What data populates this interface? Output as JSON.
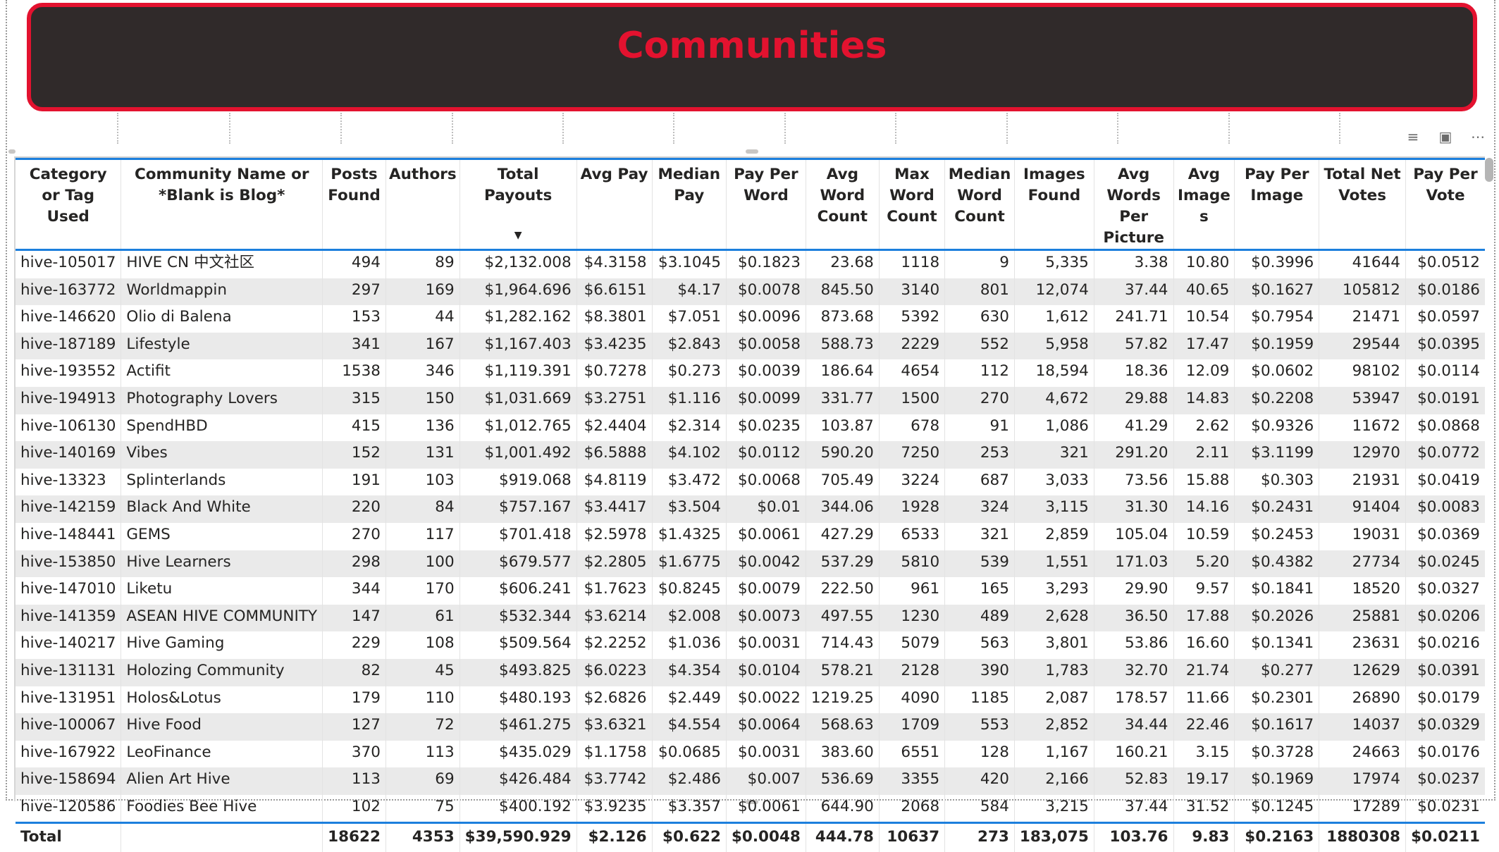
{
  "banner": {
    "title": "Communities"
  },
  "toolbar": {
    "filter_icon": "filter-icon",
    "focus_icon": "focus-mode-icon",
    "more_icon": "more-options-icon"
  },
  "colors": {
    "accent_red": "#e3122f",
    "banner_bg": "#302a2a",
    "header_rule": "#1c7fdd"
  },
  "table": {
    "sorted_column": "Total Payouts",
    "sort_direction": "descending",
    "headers": [
      "Category or Tag Used",
      "Community Name or *Blank is Blog*",
      "Posts Found",
      "Authors",
      "Total Payouts",
      "Avg Pay",
      "Median Pay",
      "Pay Per Word",
      "Avg Word Count",
      "Max Word Count",
      "Median Word Count",
      "Images Found",
      "Avg Words Per Picture",
      "Avg Image s",
      "Pay Per Image",
      "Total Net Votes",
      "Pay Per Vote"
    ],
    "rows": [
      [
        "hive-105017",
        "HIVE CN 中文社区",
        "494",
        "89",
        "$2,132.008",
        "$4.3158",
        "$3.1045",
        "$0.1823",
        "23.68",
        "1118",
        "9",
        "5,335",
        "3.38",
        "10.80",
        "$0.3996",
        "41644",
        "$0.0512"
      ],
      [
        "hive-163772",
        "Worldmappin",
        "297",
        "169",
        "$1,964.696",
        "$6.6151",
        "$4.17",
        "$0.0078",
        "845.50",
        "3140",
        "801",
        "12,074",
        "37.44",
        "40.65",
        "$0.1627",
        "105812",
        "$0.0186"
      ],
      [
        "hive-146620",
        "Olio di Balena",
        "153",
        "44",
        "$1,282.162",
        "$8.3801",
        "$7.051",
        "$0.0096",
        "873.68",
        "5392",
        "630",
        "1,612",
        "241.71",
        "10.54",
        "$0.7954",
        "21471",
        "$0.0597"
      ],
      [
        "hive-187189",
        "Lifestyle",
        "341",
        "167",
        "$1,167.403",
        "$3.4235",
        "$2.843",
        "$0.0058",
        "588.73",
        "2229",
        "552",
        "5,958",
        "57.82",
        "17.47",
        "$0.1959",
        "29544",
        "$0.0395"
      ],
      [
        "hive-193552",
        "Actifit",
        "1538",
        "346",
        "$1,119.391",
        "$0.7278",
        "$0.273",
        "$0.0039",
        "186.64",
        "4654",
        "112",
        "18,594",
        "18.36",
        "12.09",
        "$0.0602",
        "98102",
        "$0.0114"
      ],
      [
        "hive-194913",
        "Photography Lovers",
        "315",
        "150",
        "$1,031.669",
        "$3.2751",
        "$1.116",
        "$0.0099",
        "331.77",
        "1500",
        "270",
        "4,672",
        "29.88",
        "14.83",
        "$0.2208",
        "53947",
        "$0.0191"
      ],
      [
        "hive-106130",
        "SpendHBD",
        "415",
        "136",
        "$1,012.765",
        "$2.4404",
        "$2.314",
        "$0.0235",
        "103.87",
        "678",
        "91",
        "1,086",
        "41.29",
        "2.62",
        "$0.9326",
        "11672",
        "$0.0868"
      ],
      [
        "hive-140169",
        "Vibes",
        "152",
        "131",
        "$1,001.492",
        "$6.5888",
        "$4.102",
        "$0.0112",
        "590.20",
        "7250",
        "253",
        "321",
        "291.20",
        "2.11",
        "$3.1199",
        "12970",
        "$0.0772"
      ],
      [
        "hive-13323",
        "Splinterlands",
        "191",
        "103",
        "$919.068",
        "$4.8119",
        "$3.472",
        "$0.0068",
        "705.49",
        "3224",
        "687",
        "3,033",
        "73.56",
        "15.88",
        "$0.303",
        "21931",
        "$0.0419"
      ],
      [
        "hive-142159",
        "Black And White",
        "220",
        "84",
        "$757.167",
        "$3.4417",
        "$3.504",
        "$0.01",
        "344.06",
        "1928",
        "324",
        "3,115",
        "31.30",
        "14.16",
        "$0.2431",
        "91404",
        "$0.0083"
      ],
      [
        "hive-148441",
        "GEMS",
        "270",
        "117",
        "$701.418",
        "$2.5978",
        "$1.4325",
        "$0.0061",
        "427.29",
        "6533",
        "321",
        "2,859",
        "105.04",
        "10.59",
        "$0.2453",
        "19031",
        "$0.0369"
      ],
      [
        "hive-153850",
        "Hive Learners",
        "298",
        "100",
        "$679.577",
        "$2.2805",
        "$1.6775",
        "$0.0042",
        "537.29",
        "5810",
        "539",
        "1,551",
        "171.03",
        "5.20",
        "$0.4382",
        "27734",
        "$0.0245"
      ],
      [
        "hive-147010",
        "Liketu",
        "344",
        "170",
        "$606.241",
        "$1.7623",
        "$0.8245",
        "$0.0079",
        "222.50",
        "961",
        "165",
        "3,293",
        "29.90",
        "9.57",
        "$0.1841",
        "18520",
        "$0.0327"
      ],
      [
        "hive-141359",
        "ASEAN HIVE COMMUNITY",
        "147",
        "61",
        "$532.344",
        "$3.6214",
        "$2.008",
        "$0.0073",
        "497.55",
        "1230",
        "489",
        "2,628",
        "36.50",
        "17.88",
        "$0.2026",
        "25881",
        "$0.0206"
      ],
      [
        "hive-140217",
        "Hive Gaming",
        "229",
        "108",
        "$509.564",
        "$2.2252",
        "$1.036",
        "$0.0031",
        "714.43",
        "5079",
        "563",
        "3,801",
        "53.86",
        "16.60",
        "$0.1341",
        "23631",
        "$0.0216"
      ],
      [
        "hive-131131",
        "Holozing Community",
        "82",
        "45",
        "$493.825",
        "$6.0223",
        "$4.354",
        "$0.0104",
        "578.21",
        "2128",
        "390",
        "1,783",
        "32.70",
        "21.74",
        "$0.277",
        "12629",
        "$0.0391"
      ],
      [
        "hive-131951",
        "Holos&Lotus",
        "179",
        "110",
        "$480.193",
        "$2.6826",
        "$2.449",
        "$0.0022",
        "1219.25",
        "4090",
        "1185",
        "2,087",
        "178.57",
        "11.66",
        "$0.2301",
        "26890",
        "$0.0179"
      ],
      [
        "hive-100067",
        "Hive Food",
        "127",
        "72",
        "$461.275",
        "$3.6321",
        "$4.554",
        "$0.0064",
        "568.63",
        "1709",
        "553",
        "2,852",
        "34.44",
        "22.46",
        "$0.1617",
        "14037",
        "$0.0329"
      ],
      [
        "hive-167922",
        "LeoFinance",
        "370",
        "113",
        "$435.029",
        "$1.1758",
        "$0.0685",
        "$0.0031",
        "383.60",
        "6551",
        "128",
        "1,167",
        "160.21",
        "3.15",
        "$0.3728",
        "24663",
        "$0.0176"
      ],
      [
        "hive-158694",
        "Alien Art Hive",
        "113",
        "69",
        "$426.484",
        "$3.7742",
        "$2.486",
        "$0.007",
        "536.69",
        "3355",
        "420",
        "2,166",
        "52.83",
        "19.17",
        "$0.1969",
        "17974",
        "$0.0237"
      ],
      [
        "hive-120586",
        "Foodies Bee Hive",
        "102",
        "75",
        "$400.192",
        "$3.9235",
        "$3.357",
        "$0.0061",
        "644.90",
        "2068",
        "584",
        "3,215",
        "37.44",
        "31.52",
        "$0.1245",
        "17289",
        "$0.0231"
      ]
    ],
    "total": [
      "Total",
      "",
      "18622",
      "4353",
      "$39,590.929",
      "$2.126",
      "$0.622",
      "$0.0048",
      "444.78",
      "10637",
      "273",
      "183,075",
      "103.76",
      "9.83",
      "$0.2163",
      "1880308",
      "$0.0211"
    ]
  }
}
